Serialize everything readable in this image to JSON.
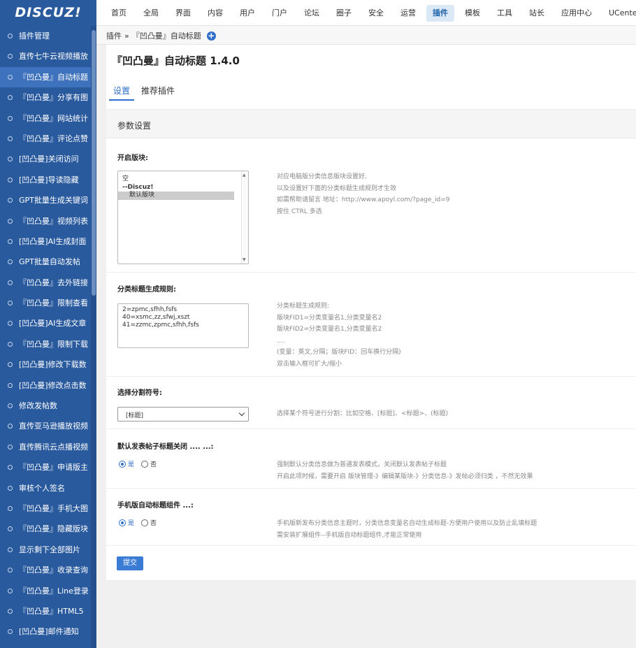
{
  "logo": {
    "text": "DISCUZ!"
  },
  "topnav": {
    "items": [
      {
        "label": "首页"
      },
      {
        "label": "全局"
      },
      {
        "label": "界面"
      },
      {
        "label": "内容"
      },
      {
        "label": "用户"
      },
      {
        "label": "门户"
      },
      {
        "label": "论坛"
      },
      {
        "label": "圈子"
      },
      {
        "label": "安全"
      },
      {
        "label": "运营"
      },
      {
        "label": "插件",
        "active": true
      },
      {
        "label": "模板"
      },
      {
        "label": "工具"
      },
      {
        "label": "站长"
      },
      {
        "label": "应用中心"
      },
      {
        "label": "UCenter"
      }
    ]
  },
  "sidebar": {
    "items": [
      {
        "label": "插件管理"
      },
      {
        "label": "直传七牛云视频播放"
      },
      {
        "label": "『凹凸曼』自动标题",
        "active": true
      },
      {
        "label": "『凹凸曼』分享有图"
      },
      {
        "label": "『凹凸曼』网站统计"
      },
      {
        "label": "『凹凸曼』评论点赞"
      },
      {
        "label": "[凹凸曼]关闭访问"
      },
      {
        "label": "[凹凸曼]导读隐藏"
      },
      {
        "label": "GPT批量生成关键词"
      },
      {
        "label": "『凹凸曼』视频列表"
      },
      {
        "label": "[凹凸曼]AI生成封面"
      },
      {
        "label": "GPT批量自动发帖"
      },
      {
        "label": "『凹凸曼』去外链接"
      },
      {
        "label": "『凹凸曼』限制查看"
      },
      {
        "label": "[凹凸曼]AI生成文章"
      },
      {
        "label": "『凹凸曼』限制下载"
      },
      {
        "label": "[凹凸曼]修改下载数"
      },
      {
        "label": "[凹凸曼]修改点击数"
      },
      {
        "label": "修改发帖数"
      },
      {
        "label": "直传亚马逊播放视频"
      },
      {
        "label": "直传腾讯云点播视频"
      },
      {
        "label": "『凹凸曼』申请版主"
      },
      {
        "label": "审核个人签名"
      },
      {
        "label": "『凹凸曼』手机大图"
      },
      {
        "label": "『凹凸曼』隐藏版块"
      },
      {
        "label": "显示剩下全部图片"
      },
      {
        "label": "『凹凸曼』收录查询"
      },
      {
        "label": "『凹凸曼』Line登录"
      },
      {
        "label": "『凹凸曼』HTML5"
      },
      {
        "label": "[凹凸曼]邮件通知"
      }
    ]
  },
  "breadcrumb": {
    "root": "插件",
    "separator": "»",
    "current": "『凹凸曼』自动标题",
    "add_symbol": "+"
  },
  "header": {
    "title": "『凹凸曼』自动标题 1.4.0",
    "tabs": [
      {
        "label": "设置",
        "active": true
      },
      {
        "label": "推荐插件"
      }
    ]
  },
  "section": {
    "title": "参数设置"
  },
  "fields": {
    "forum": {
      "label": "开启版块:",
      "options": [
        "空",
        "--Discuz!",
        "默认版块"
      ],
      "selected_index": 2,
      "hint": [
        "对应电脑版分类信息版块设置好,",
        "以及设置好下面的分类标题生成规则才生效",
        "如需帮助请留言 地址：http://www.apoyl.com/?page_id=9",
        "按住 CTRL 多选"
      ]
    },
    "rule": {
      "label": "分类标题生成规则:",
      "lines": [
        "2=zpmc,sfhh,fsfs",
        "40=xsmc,zz,sfwj,xszt",
        "41=zzmc,zpmc,sfhh,fsfs"
      ],
      "hint": [
        "分类标题生成规则:",
        "版块FID1=分类变量名1,分类变量名2",
        "版块FID2=分类变量名1,分类变量名2",
        "....",
        "(变量：英文,分隔；版块FID：回车换行分隔)",
        "双击输入框可扩大/缩小"
      ]
    },
    "separator": {
      "label": "选择分割符号:",
      "value": "[标题]",
      "hint": "选择某个符号进行分割：比如空格、[标题]、<标题>、(标题)"
    },
    "default_close": {
      "label": "默认发表帖子标题关闭 .... ...:",
      "yes": "是",
      "no": "否",
      "value": "yes",
      "hint": [
        "强制默认分类信息做为普通发表模式，关闭默认发表帖子标题",
        "开启此项时候，需要开启 版块管理-》编辑某版块-》分类信息-》发帖必须归类 ，不然无效果"
      ]
    },
    "mobile_component": {
      "label": "手机版自动标题组件 ...:",
      "yes": "是",
      "no": "否",
      "value": "yes",
      "hint": [
        "手机版新发布分类信息主题时，分类信息变量名自动生成标题-方便用户使用以及防止乱填标题",
        "需安装扩展组件--手机版自动标题组件,才能正常使用"
      ]
    }
  },
  "submit": {
    "label": "提交"
  },
  "colors": {
    "sidebar_bg": "#2a5a9e",
    "accent": "#2f6fc9",
    "active_tab_bg": "#dbe9f7"
  }
}
